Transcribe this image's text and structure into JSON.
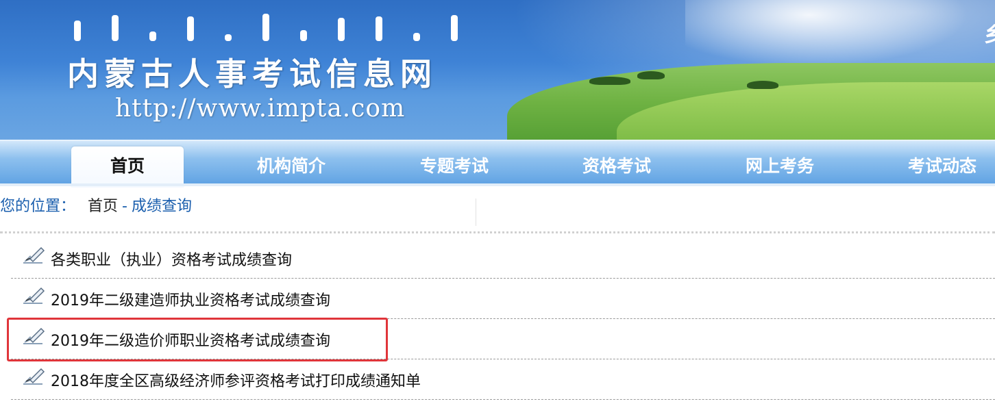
{
  "header": {
    "site_title": "内蒙古人事考试信息网",
    "site_url": "http://www.impta.com",
    "corner_text": "乡"
  },
  "nav": {
    "items": [
      {
        "label": "首页",
        "active": true
      },
      {
        "label": "机构简介",
        "active": false
      },
      {
        "label": "专题考试",
        "active": false
      },
      {
        "label": "资格考试",
        "active": false
      },
      {
        "label": "网上考务",
        "active": false
      },
      {
        "label": "考试动态",
        "active": false
      }
    ]
  },
  "breadcrumb": {
    "prefix": "您的位置：",
    "home": "首页",
    "separator": "-",
    "current": "成绩查询"
  },
  "list": {
    "icon": "edit-pen-icon",
    "items": [
      {
        "text": "各类职业（执业）资格考试成绩查询"
      },
      {
        "text": "2019年二级建造师执业资格考试成绩查询"
      },
      {
        "text": "2019年二级造价师职业资格考试成绩查询",
        "highlighted": true
      },
      {
        "text": "2018年度全区高级经济师参评资格考试打印成绩通知单"
      }
    ]
  },
  "colors": {
    "banner_blue": "#3f83d6",
    "nav_blue": "#5fa2e3",
    "link_blue": "#1b5fae",
    "highlight_red": "#e0353a"
  }
}
